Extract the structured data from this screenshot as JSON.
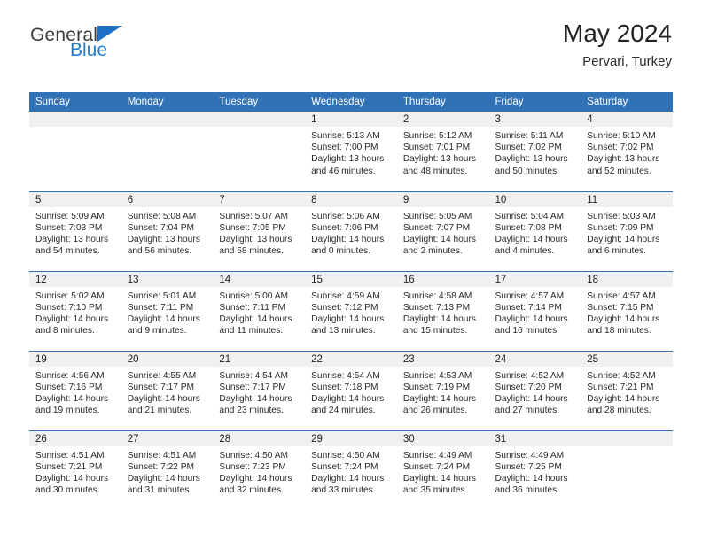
{
  "brand": {
    "name_part1": "General",
    "name_part2": "Blue",
    "triangle_color": "#1f6fc4",
    "blue_color": "#1f7fd4"
  },
  "header": {
    "title": "May 2024",
    "subtitle": "Pervari, Turkey"
  },
  "theme": {
    "header_blue": "#3172b6",
    "daynum_gray": "#f0f0f0",
    "text": "#222222"
  },
  "weekday_headers": [
    "Sunday",
    "Monday",
    "Tuesday",
    "Wednesday",
    "Thursday",
    "Friday",
    "Saturday"
  ],
  "weeks": [
    [
      {
        "day": "",
        "sunrise": "",
        "sunset": "",
        "daylight_line1": "",
        "daylight_line2": ""
      },
      {
        "day": "",
        "sunrise": "",
        "sunset": "",
        "daylight_line1": "",
        "daylight_line2": ""
      },
      {
        "day": "",
        "sunrise": "",
        "sunset": "",
        "daylight_line1": "",
        "daylight_line2": ""
      },
      {
        "day": "1",
        "sunrise": "Sunrise: 5:13 AM",
        "sunset": "Sunset: 7:00 PM",
        "daylight_line1": "Daylight: 13 hours",
        "daylight_line2": "and 46 minutes."
      },
      {
        "day": "2",
        "sunrise": "Sunrise: 5:12 AM",
        "sunset": "Sunset: 7:01 PM",
        "daylight_line1": "Daylight: 13 hours",
        "daylight_line2": "and 48 minutes."
      },
      {
        "day": "3",
        "sunrise": "Sunrise: 5:11 AM",
        "sunset": "Sunset: 7:02 PM",
        "daylight_line1": "Daylight: 13 hours",
        "daylight_line2": "and 50 minutes."
      },
      {
        "day": "4",
        "sunrise": "Sunrise: 5:10 AM",
        "sunset": "Sunset: 7:02 PM",
        "daylight_line1": "Daylight: 13 hours",
        "daylight_line2": "and 52 minutes."
      }
    ],
    [
      {
        "day": "5",
        "sunrise": "Sunrise: 5:09 AM",
        "sunset": "Sunset: 7:03 PM",
        "daylight_line1": "Daylight: 13 hours",
        "daylight_line2": "and 54 minutes."
      },
      {
        "day": "6",
        "sunrise": "Sunrise: 5:08 AM",
        "sunset": "Sunset: 7:04 PM",
        "daylight_line1": "Daylight: 13 hours",
        "daylight_line2": "and 56 minutes."
      },
      {
        "day": "7",
        "sunrise": "Sunrise: 5:07 AM",
        "sunset": "Sunset: 7:05 PM",
        "daylight_line1": "Daylight: 13 hours",
        "daylight_line2": "and 58 minutes."
      },
      {
        "day": "8",
        "sunrise": "Sunrise: 5:06 AM",
        "sunset": "Sunset: 7:06 PM",
        "daylight_line1": "Daylight: 14 hours",
        "daylight_line2": "and 0 minutes."
      },
      {
        "day": "9",
        "sunrise": "Sunrise: 5:05 AM",
        "sunset": "Sunset: 7:07 PM",
        "daylight_line1": "Daylight: 14 hours",
        "daylight_line2": "and 2 minutes."
      },
      {
        "day": "10",
        "sunrise": "Sunrise: 5:04 AM",
        "sunset": "Sunset: 7:08 PM",
        "daylight_line1": "Daylight: 14 hours",
        "daylight_line2": "and 4 minutes."
      },
      {
        "day": "11",
        "sunrise": "Sunrise: 5:03 AM",
        "sunset": "Sunset: 7:09 PM",
        "daylight_line1": "Daylight: 14 hours",
        "daylight_line2": "and 6 minutes."
      }
    ],
    [
      {
        "day": "12",
        "sunrise": "Sunrise: 5:02 AM",
        "sunset": "Sunset: 7:10 PM",
        "daylight_line1": "Daylight: 14 hours",
        "daylight_line2": "and 8 minutes."
      },
      {
        "day": "13",
        "sunrise": "Sunrise: 5:01 AM",
        "sunset": "Sunset: 7:11 PM",
        "daylight_line1": "Daylight: 14 hours",
        "daylight_line2": "and 9 minutes."
      },
      {
        "day": "14",
        "sunrise": "Sunrise: 5:00 AM",
        "sunset": "Sunset: 7:11 PM",
        "daylight_line1": "Daylight: 14 hours",
        "daylight_line2": "and 11 minutes."
      },
      {
        "day": "15",
        "sunrise": "Sunrise: 4:59 AM",
        "sunset": "Sunset: 7:12 PM",
        "daylight_line1": "Daylight: 14 hours",
        "daylight_line2": "and 13 minutes."
      },
      {
        "day": "16",
        "sunrise": "Sunrise: 4:58 AM",
        "sunset": "Sunset: 7:13 PM",
        "daylight_line1": "Daylight: 14 hours",
        "daylight_line2": "and 15 minutes."
      },
      {
        "day": "17",
        "sunrise": "Sunrise: 4:57 AM",
        "sunset": "Sunset: 7:14 PM",
        "daylight_line1": "Daylight: 14 hours",
        "daylight_line2": "and 16 minutes."
      },
      {
        "day": "18",
        "sunrise": "Sunrise: 4:57 AM",
        "sunset": "Sunset: 7:15 PM",
        "daylight_line1": "Daylight: 14 hours",
        "daylight_line2": "and 18 minutes."
      }
    ],
    [
      {
        "day": "19",
        "sunrise": "Sunrise: 4:56 AM",
        "sunset": "Sunset: 7:16 PM",
        "daylight_line1": "Daylight: 14 hours",
        "daylight_line2": "and 19 minutes."
      },
      {
        "day": "20",
        "sunrise": "Sunrise: 4:55 AM",
        "sunset": "Sunset: 7:17 PM",
        "daylight_line1": "Daylight: 14 hours",
        "daylight_line2": "and 21 minutes."
      },
      {
        "day": "21",
        "sunrise": "Sunrise: 4:54 AM",
        "sunset": "Sunset: 7:17 PM",
        "daylight_line1": "Daylight: 14 hours",
        "daylight_line2": "and 23 minutes."
      },
      {
        "day": "22",
        "sunrise": "Sunrise: 4:54 AM",
        "sunset": "Sunset: 7:18 PM",
        "daylight_line1": "Daylight: 14 hours",
        "daylight_line2": "and 24 minutes."
      },
      {
        "day": "23",
        "sunrise": "Sunrise: 4:53 AM",
        "sunset": "Sunset: 7:19 PM",
        "daylight_line1": "Daylight: 14 hours",
        "daylight_line2": "and 26 minutes."
      },
      {
        "day": "24",
        "sunrise": "Sunrise: 4:52 AM",
        "sunset": "Sunset: 7:20 PM",
        "daylight_line1": "Daylight: 14 hours",
        "daylight_line2": "and 27 minutes."
      },
      {
        "day": "25",
        "sunrise": "Sunrise: 4:52 AM",
        "sunset": "Sunset: 7:21 PM",
        "daylight_line1": "Daylight: 14 hours",
        "daylight_line2": "and 28 minutes."
      }
    ],
    [
      {
        "day": "26",
        "sunrise": "Sunrise: 4:51 AM",
        "sunset": "Sunset: 7:21 PM",
        "daylight_line1": "Daylight: 14 hours",
        "daylight_line2": "and 30 minutes."
      },
      {
        "day": "27",
        "sunrise": "Sunrise: 4:51 AM",
        "sunset": "Sunset: 7:22 PM",
        "daylight_line1": "Daylight: 14 hours",
        "daylight_line2": "and 31 minutes."
      },
      {
        "day": "28",
        "sunrise": "Sunrise: 4:50 AM",
        "sunset": "Sunset: 7:23 PM",
        "daylight_line1": "Daylight: 14 hours",
        "daylight_line2": "and 32 minutes."
      },
      {
        "day": "29",
        "sunrise": "Sunrise: 4:50 AM",
        "sunset": "Sunset: 7:24 PM",
        "daylight_line1": "Daylight: 14 hours",
        "daylight_line2": "and 33 minutes."
      },
      {
        "day": "30",
        "sunrise": "Sunrise: 4:49 AM",
        "sunset": "Sunset: 7:24 PM",
        "daylight_line1": "Daylight: 14 hours",
        "daylight_line2": "and 35 minutes."
      },
      {
        "day": "31",
        "sunrise": "Sunrise: 4:49 AM",
        "sunset": "Sunset: 7:25 PM",
        "daylight_line1": "Daylight: 14 hours",
        "daylight_line2": "and 36 minutes."
      },
      {
        "day": "",
        "sunrise": "",
        "sunset": "",
        "daylight_line1": "",
        "daylight_line2": ""
      }
    ]
  ]
}
